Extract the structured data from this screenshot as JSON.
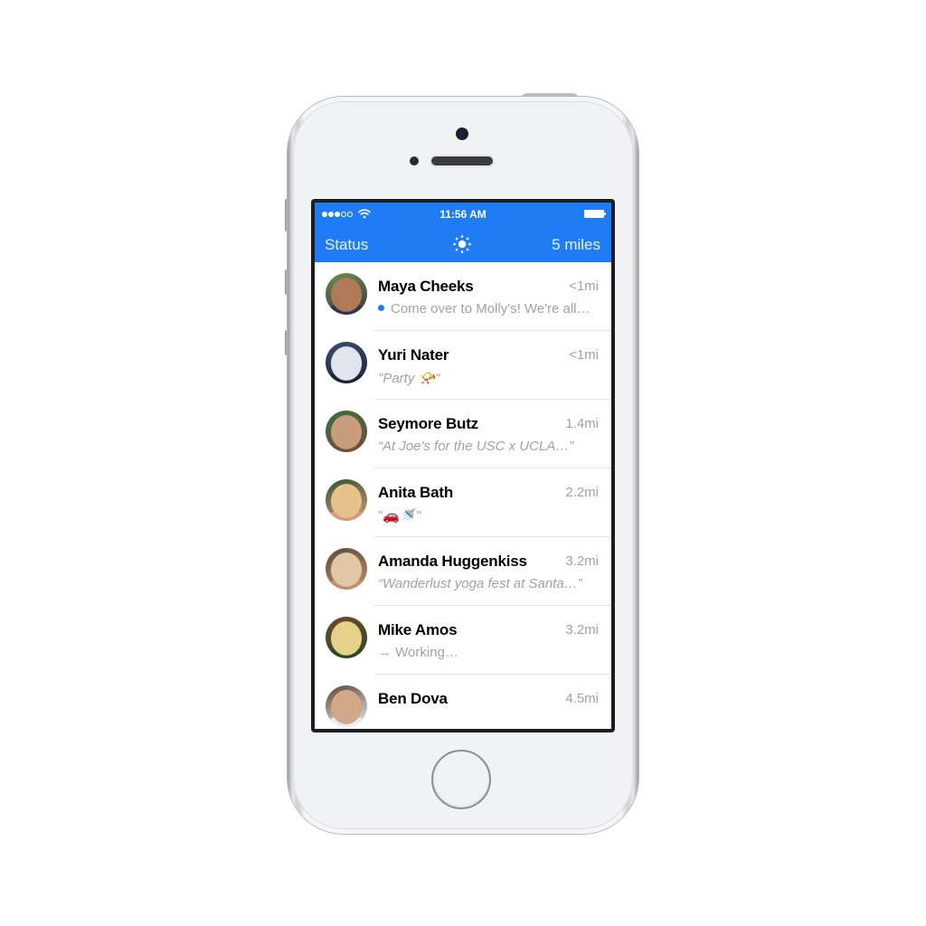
{
  "statusbar": {
    "signal_bars_filled": 3,
    "signal_bars_total": 5,
    "wifi": "wifi-icon",
    "time": "11:56 AM",
    "battery_level": 1.0
  },
  "navbar": {
    "left_label": "Status",
    "center_icon": "radar-sun-icon",
    "right_label": "5 miles"
  },
  "colors": {
    "accent": "#1f7cf5",
    "secondary_text": "#a2a2a6",
    "separator": "#e3e3e6"
  },
  "contacts": [
    {
      "name": "Maya Cheeks",
      "distance": "<1mi",
      "message": "Come over to Molly's! We're all…",
      "unread": true,
      "italic": false,
      "avatar_colors": [
        "#6c8f4a",
        "#b07a56",
        "#33364a"
      ]
    },
    {
      "name": "Yuri Nater",
      "distance": "<1mi",
      "message": "\"Party 📯\"",
      "unread": false,
      "italic": true,
      "avatar_colors": [
        "#3c4d6b",
        "#dfe6ee",
        "#1c2433"
      ]
    },
    {
      "name": "Seymore Butz",
      "distance": "1.4mi",
      "message": "“At Joe's for the USC x UCLA…”",
      "unread": false,
      "italic": true,
      "avatar_colors": [
        "#3d6b44",
        "#c99c7e",
        "#6b5036"
      ]
    },
    {
      "name": "Anita Bath",
      "distance": "2.2mi",
      "message": "\"🚗🚿\"",
      "unread": false,
      "italic": false,
      "avatar_colors": [
        "#2f5232",
        "#e6c28a",
        "#d69b7e"
      ]
    },
    {
      "name": "Amanda Huggenkiss",
      "distance": "3.2mi",
      "message": "“Wanderlust yoga fest at Santa…”",
      "unread": false,
      "italic": true,
      "avatar_colors": [
        "#5a4a3a",
        "#e2c7a6",
        "#c28e70"
      ]
    },
    {
      "name": "Mike Amos",
      "distance": "3.2mi",
      "message": "→ Working…",
      "unread": false,
      "italic": false,
      "avatar_colors": [
        "#6b4a2a",
        "#e6d08a",
        "#2c4a22"
      ]
    },
    {
      "name": "Ben Dova",
      "distance": "4.5mi",
      "message": "",
      "unread": false,
      "italic": false,
      "avatar_colors": [
        "#5b4636",
        "#d3a88a",
        "#e9eef0"
      ]
    }
  ]
}
